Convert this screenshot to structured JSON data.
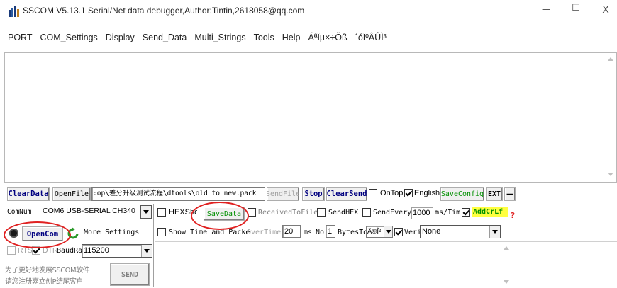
{
  "window": {
    "title": "SSCOM V5.13.1 Serial/Net data debugger,Author:Tintin,2618058@qq.com",
    "controls": {
      "minimize": "—",
      "maximize": "☐",
      "close": "X"
    }
  },
  "menu": [
    "PORT",
    "COM_Settings",
    "Display",
    "Send_Data",
    "Multi_Strings",
    "Tools",
    "Help",
    "ÁªÏµ×÷Õß",
    "´óÏºÂÛÌ³"
  ],
  "toolbar": {
    "clear_data": "ClearData",
    "open_file": "OpenFile",
    "file_path": ":op\\差分升级测试流程\\dtools\\old_to_new.pack",
    "send_file": "SendFile",
    "stop": "Stop",
    "clear_send": "ClearSend",
    "on_top": "OnTop",
    "english": "English",
    "save_config": "SaveConfig",
    "ext": "EXT",
    "collapse": "—"
  },
  "port": {
    "com_num_label": "ComNum",
    "com_value": "COM6 USB-SERIAL CH340",
    "open_com": "OpenCom",
    "more_settings": "More Settings",
    "rts": "RTS",
    "dtr": "DTR",
    "baud_label": "BaudRat",
    "baud_value": "115200"
  },
  "options": {
    "hex_show": "HEXShow",
    "save_data": "SaveData",
    "received_to_file": "ReceivedToFile",
    "send_hex": "SendHEX",
    "send_every": "SendEvery:",
    "send_every_value": "1000",
    "ms_tim": "ms/Tim",
    "add_crlf": "AddCrLf",
    "show_time": "Show Time and Packe",
    "overtime": "OverTime:",
    "overtime_value": "20",
    "ms": "ms",
    "no": "No",
    "no_value": "1",
    "bytes_to": "BytesTo",
    "bytes_to_value": "Ä©Î²",
    "verify": "Verify",
    "verify_value": "None"
  },
  "promo": {
    "line1": "为了更好地发展SSCOM软件",
    "line2": "请您注册嘉立创P结尾客户",
    "send": "SEND"
  },
  "colors": {
    "bg": "#ffffff",
    "button": "#f0f0f0",
    "highlight": "#ffff40",
    "annotation": "#e02020",
    "green": "#009000"
  }
}
